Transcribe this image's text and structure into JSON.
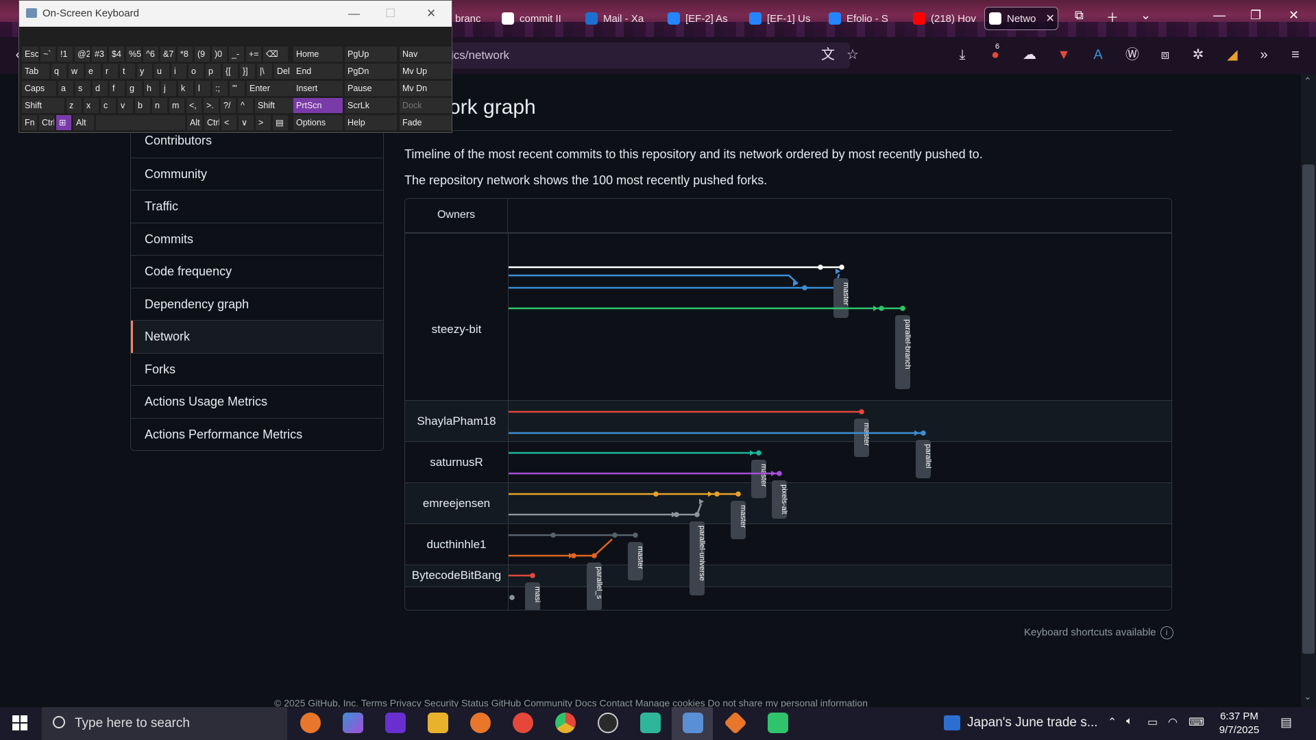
{
  "browser": {
    "tabs": [
      {
        "label": "branc",
        "color": "#c94a4a"
      },
      {
        "label": "commit II",
        "color": "#ffffff"
      },
      {
        "label": "Mail - Xa",
        "color": "#1e6fd0"
      },
      {
        "label": "[EF-2] As",
        "color": "#2684ff"
      },
      {
        "label": "[EF-1] Us",
        "color": "#2684ff"
      },
      {
        "label": "Efolio - S",
        "color": "#2684ff"
      },
      {
        "label": "(218) Hov",
        "color": "#ff0000"
      },
      {
        "label": "Netwo",
        "color": "#ffffff"
      }
    ],
    "url": "ics/network",
    "badge_count": "6"
  },
  "osk": {
    "title": "On-Screen Keyboard",
    "rows": [
      [
        "Esc",
        "~`",
        "!1",
        "@2",
        "#3",
        "$4",
        "%5",
        "^6",
        "&7",
        "*8",
        "(9",
        ")0",
        "_-",
        "+=",
        "⌫"
      ],
      [
        "Tab",
        "q",
        "w",
        "e",
        "r",
        "t",
        "y",
        "u",
        "i",
        "o",
        "p",
        "{[",
        "}]",
        "|\\",
        "Del"
      ],
      [
        "Caps",
        "a",
        "s",
        "d",
        "f",
        "g",
        "h",
        "j",
        "k",
        "l",
        ":;",
        "\"'",
        "Enter"
      ],
      [
        "Shift",
        "z",
        "x",
        "c",
        "v",
        "b",
        "n",
        "m",
        "<,",
        ">.",
        "?/",
        "^",
        "Shift"
      ],
      [
        "Fn",
        "Ctrl",
        "⊞",
        "Alt",
        "",
        "Alt",
        "Ctrl",
        "<",
        "∨",
        ">",
        "▤"
      ]
    ],
    "side_keys": [
      [
        "Home",
        "PgUp",
        "Nav"
      ],
      [
        "End",
        "PgDn",
        "Mv Up"
      ],
      [
        "Insert",
        "Pause",
        "Mv Dn"
      ],
      [
        "PrtScn",
        "ScrLk",
        "Dock"
      ],
      [
        "Options",
        "Help",
        "Fade"
      ]
    ]
  },
  "sidebar": {
    "items": [
      "Contributors",
      "Community",
      "Traffic",
      "Commits",
      "Code frequency",
      "Dependency graph",
      "Network",
      "Forks",
      "Actions Usage Metrics",
      "Actions Performance Metrics"
    ],
    "active": "Network"
  },
  "main": {
    "title": "ork graph",
    "desc1": "Timeline of the most recent commits to this repository and its network ordered by most recently pushed to.",
    "desc2": "The repository network shows the 100 most recently pushed forks.",
    "owners_header": "Owners",
    "owners": [
      "steezy-bit",
      "ShaylaPham18",
      "saturnusR",
      "emreejensen",
      "ducthinhle1",
      "BytecodeBitBang"
    ],
    "branch_labels": [
      "master",
      "parallel-branch",
      "master",
      "parallel",
      "master",
      "pixels-alt",
      "master",
      "parallel-universe",
      "master",
      "parallel_s",
      "masi"
    ],
    "colors": {
      "white": "#ffffff",
      "blue": "#3b8fd6",
      "green": "#2fc46b",
      "red": "#e5483b",
      "teal": "#1fb59a",
      "purple": "#a54fd6",
      "orange": "#e8a22b",
      "gray": "#8b949e",
      "darkgray": "#59636e",
      "dorange": "#e2651f"
    },
    "keyboard_note": "Keyboard shortcuts available",
    "footer": "© 2025 GitHub, Inc.   Terms   Privacy   Security   Status   GitHub Community   Docs   Contact   Manage cookies   Do not share my personal information"
  },
  "taskbar": {
    "search_placeholder": "Type here to search",
    "news": "Japan's June trade s...",
    "time": "6:37 PM",
    "date": "9/7/2025"
  }
}
